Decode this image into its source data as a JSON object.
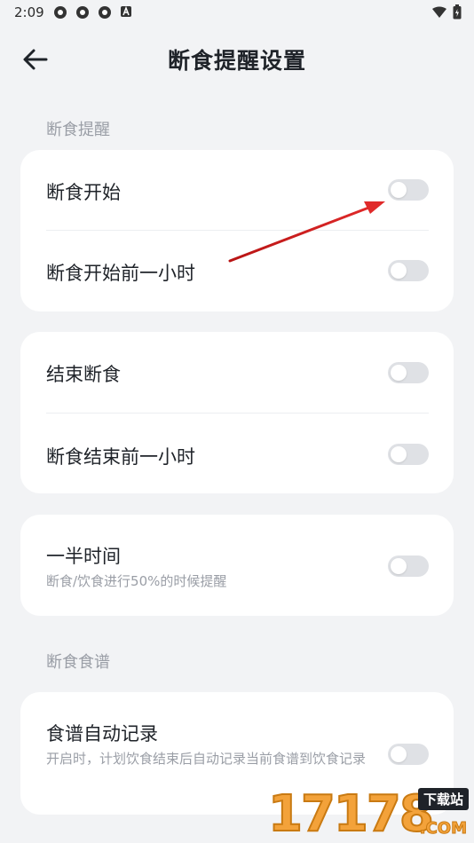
{
  "status_bar": {
    "time": "2:09",
    "icons": [
      "app-icon",
      "app-icon",
      "app-icon",
      "a-icon"
    ],
    "right_icons": [
      "wifi-icon",
      "battery-icon"
    ]
  },
  "header": {
    "title": "断食提醒设置",
    "back_icon": "arrow-left-icon"
  },
  "sections": {
    "fasting_reminder": "断食提醒",
    "fasting_recipe": "断食食谱"
  },
  "cards": {
    "start": {
      "row1": {
        "label": "断食开始",
        "enabled": false
      },
      "row2": {
        "label": "断食开始前一小时",
        "enabled": false
      }
    },
    "end": {
      "row1": {
        "label": "结束断食",
        "enabled": false
      },
      "row2": {
        "label": "断食结束前一小时",
        "enabled": false
      }
    },
    "half": {
      "label": "一半时间",
      "desc": "断食/饮食进行50%的时候提醒",
      "enabled": false
    },
    "recipe": {
      "label": "食谱自动记录",
      "desc": "开启时，计划饮食结束后自动记录当前食谱到饮食记录",
      "enabled": false
    }
  },
  "watermark": {
    "digits": "17178",
    "badge": "下载站",
    "suffix": ".COM"
  },
  "colors": {
    "background": "#f2f3f5",
    "card": "#ffffff",
    "toggle_off": "#dfe1e5",
    "annotation_arrow": "#d42020",
    "watermark_orange": "#f3a23a"
  }
}
